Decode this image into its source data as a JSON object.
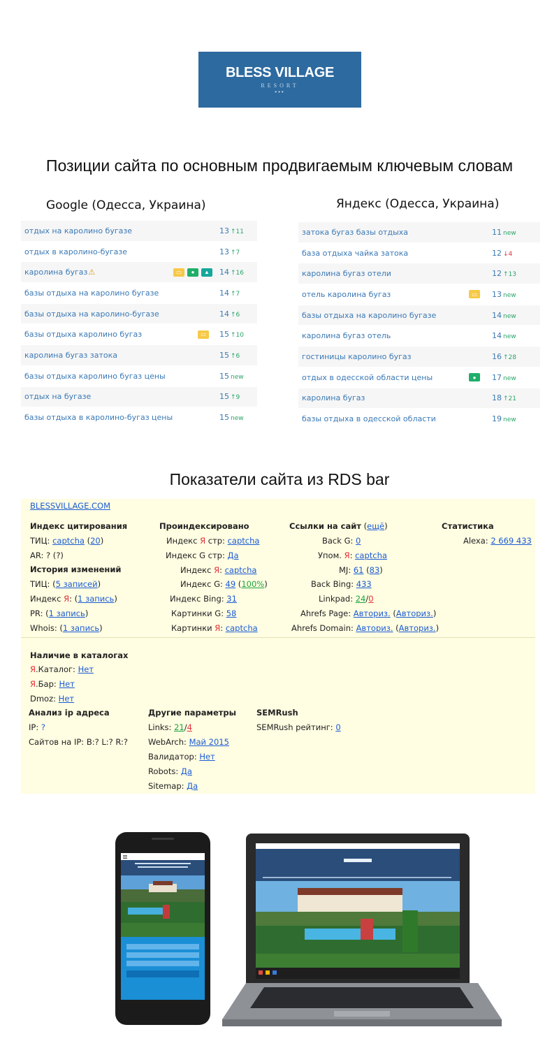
{
  "logo": {
    "name": "BLESS VILLAGE",
    "sub": "RESORT",
    "dots": "•••"
  },
  "title_positions": "Позиции сайта по основным продвигаемым ключевым словам",
  "google": {
    "title": "Google (Одесса, Украина)",
    "rows": [
      {
        "kw": "отдых на каролино бугазе",
        "pos": "13",
        "chg": "11",
        "dir": "up"
      },
      {
        "kw": "отдых в каролино-бугазе",
        "pos": "13",
        "chg": "7",
        "dir": "up"
      },
      {
        "kw": "каролина бугаз",
        "pos": "14",
        "chg": "16",
        "dir": "up",
        "warn": true,
        "icons": [
          "yellow",
          "green",
          "teal"
        ]
      },
      {
        "kw": "базы отдыха на каролино бугазе",
        "pos": "14",
        "chg": "7",
        "dir": "up"
      },
      {
        "kw": "базы отдыха на каролино-бугазе",
        "pos": "14",
        "chg": "6",
        "dir": "up"
      },
      {
        "kw": "базы отдыха каролино бугаз",
        "pos": "15",
        "chg": "10",
        "dir": "up",
        "icons": [
          "yellow"
        ]
      },
      {
        "kw": "каролина бугаз затока",
        "pos": "15",
        "chg": "6",
        "dir": "up"
      },
      {
        "kw": "базы отдыха каролино бугаз цены",
        "pos": "15",
        "chg": "new",
        "dir": "new"
      },
      {
        "kw": "отдых на бугазе",
        "pos": "15",
        "chg": "9",
        "dir": "up"
      },
      {
        "kw": "базы отдыха в каролино-бугаз цены",
        "pos": "15",
        "chg": "new",
        "dir": "new"
      }
    ]
  },
  "yandex": {
    "title": "Яндекс (Одесса, Украина)",
    "rows": [
      {
        "kw": "затока бугаз базы отдыха",
        "pos": "11",
        "chg": "new",
        "dir": "new"
      },
      {
        "kw": "база отдыха чайка затока",
        "pos": "12",
        "chg": "4",
        "dir": "down"
      },
      {
        "kw": "каролина бугаз отели",
        "pos": "12",
        "chg": "13",
        "dir": "up"
      },
      {
        "kw": "отель каролина бугаз",
        "pos": "13",
        "chg": "new",
        "dir": "new",
        "icons": [
          "yellow"
        ]
      },
      {
        "kw": "базы отдыха на каролино бугазе",
        "pos": "14",
        "chg": "new",
        "dir": "new"
      },
      {
        "kw": "каролина бугаз отель",
        "pos": "14",
        "chg": "new",
        "dir": "new"
      },
      {
        "kw": "гостиницы каролино бугаз",
        "pos": "16",
        "chg": "28",
        "dir": "up"
      },
      {
        "kw": "отдых в одесской области цены",
        "pos": "17",
        "chg": "new",
        "dir": "new",
        "icons": [
          "green"
        ]
      },
      {
        "kw": "каролина бугаз",
        "pos": "18",
        "chg": "21",
        "dir": "up"
      },
      {
        "kw": "базы отдыха в одесской области",
        "pos": "19",
        "chg": "new",
        "dir": "new"
      }
    ]
  },
  "title_rds": "Показатели сайта из RDS bar",
  "rds": {
    "domain": "BLESSVILLAGE.COM",
    "col1": {
      "h1": "Индекс цитирования",
      "tic_label": "ТИЦ:",
      "tic_val": "captcha",
      "tic_extra": "20",
      "ar_label": "AR:",
      "ar_val": "?",
      "ar_extra": "?",
      "h2": "История изменений",
      "hist_tic_label": "ТИЦ:",
      "hist_tic_val": "5 записей",
      "hist_idx_label": "Индекс",
      "hist_idx_ya": "Я",
      "hist_idx_val": "1 запись",
      "pr_label": "PR:",
      "pr_val": "1 запись",
      "whois_label": "Whois:",
      "whois_val": "1 запись"
    },
    "col2": {
      "h": "Проиндексировано",
      "r1_a": "Индекс",
      "r1_ya": "Я",
      "r1_b": "стр:",
      "r1_val": "captcha",
      "r2_label": "Индекс G стр:",
      "r2_val": "Да",
      "r3_a": "Индекс",
      "r3_ya": "Я",
      "r3_val": "captcha",
      "r4_label": "Индекс G:",
      "r4_val": "49",
      "r4_extra": "100%",
      "r5_label": "Индекс Bing:",
      "r5_val": "31",
      "r6_label": "Картинки G:",
      "r6_val": "58",
      "r7_a": "Картинки",
      "r7_ya": "Я",
      "r7_val": "captcha"
    },
    "col3": {
      "h": "Ссылки на сайт",
      "h_more": "ещё",
      "r1_label": "Back G:",
      "r1_val": "0",
      "r2_a": "Упом.",
      "r2_ya": "Я",
      "r2_val": "captcha",
      "r3_label": "MJ:",
      "r3_val": "61",
      "r3_extra": "83",
      "r4_label": "Back Bing:",
      "r4_val": "433",
      "r5_label": "Linkpad:",
      "r5_val1": "24",
      "r5_val2": "0",
      "r6_label": "Ahrefs Page:",
      "r6_val": "Авториз.",
      "r6_extra": "Авториз.",
      "r7_label": "Ahrefs Domain:",
      "r7_val": "Авториз.",
      "r7_extra": "Авториз."
    },
    "col4": {
      "h": "Статистика",
      "alexa_label": "Alexa:",
      "alexa_val": "2 669 433"
    },
    "catalogs": {
      "h": "Наличие в каталогах",
      "r1_ya": "Я",
      "r1_label": ".Каталог:",
      "r1_val": "Нет",
      "r2_ya": "Я",
      "r2_label": ".Бар:",
      "r2_val": "Нет",
      "r3_label": "Dmoz:",
      "r3_val": "Нет"
    },
    "ip": {
      "h": "Анализ ip адреса",
      "ip_label": "IP:",
      "ip_val": "?",
      "sites_label": "Сайтов на IP:",
      "sites_val": "B:? L:? R:?"
    },
    "other": {
      "h": "Другие параметры",
      "links_label": "Links:",
      "links_val1": "21",
      "links_val2": "4",
      "webarch_label": "WebArch:",
      "webarch_val": "Май 2015",
      "validator_label": "Валидатор:",
      "validator_val": "Нет",
      "robots_label": "Robots:",
      "robots_val": "Да",
      "sitemap_label": "Sitemap:",
      "sitemap_val": "Да"
    },
    "semrush": {
      "h": "SEMRush",
      "label": "SEMRush рейтинг:",
      "val": "0"
    }
  },
  "colors": {
    "brand": "#2d6aa0",
    "link": "#3b79b5",
    "up": "#2aa56a",
    "down": "#e0303a",
    "rds_bg": "#fffde2"
  }
}
